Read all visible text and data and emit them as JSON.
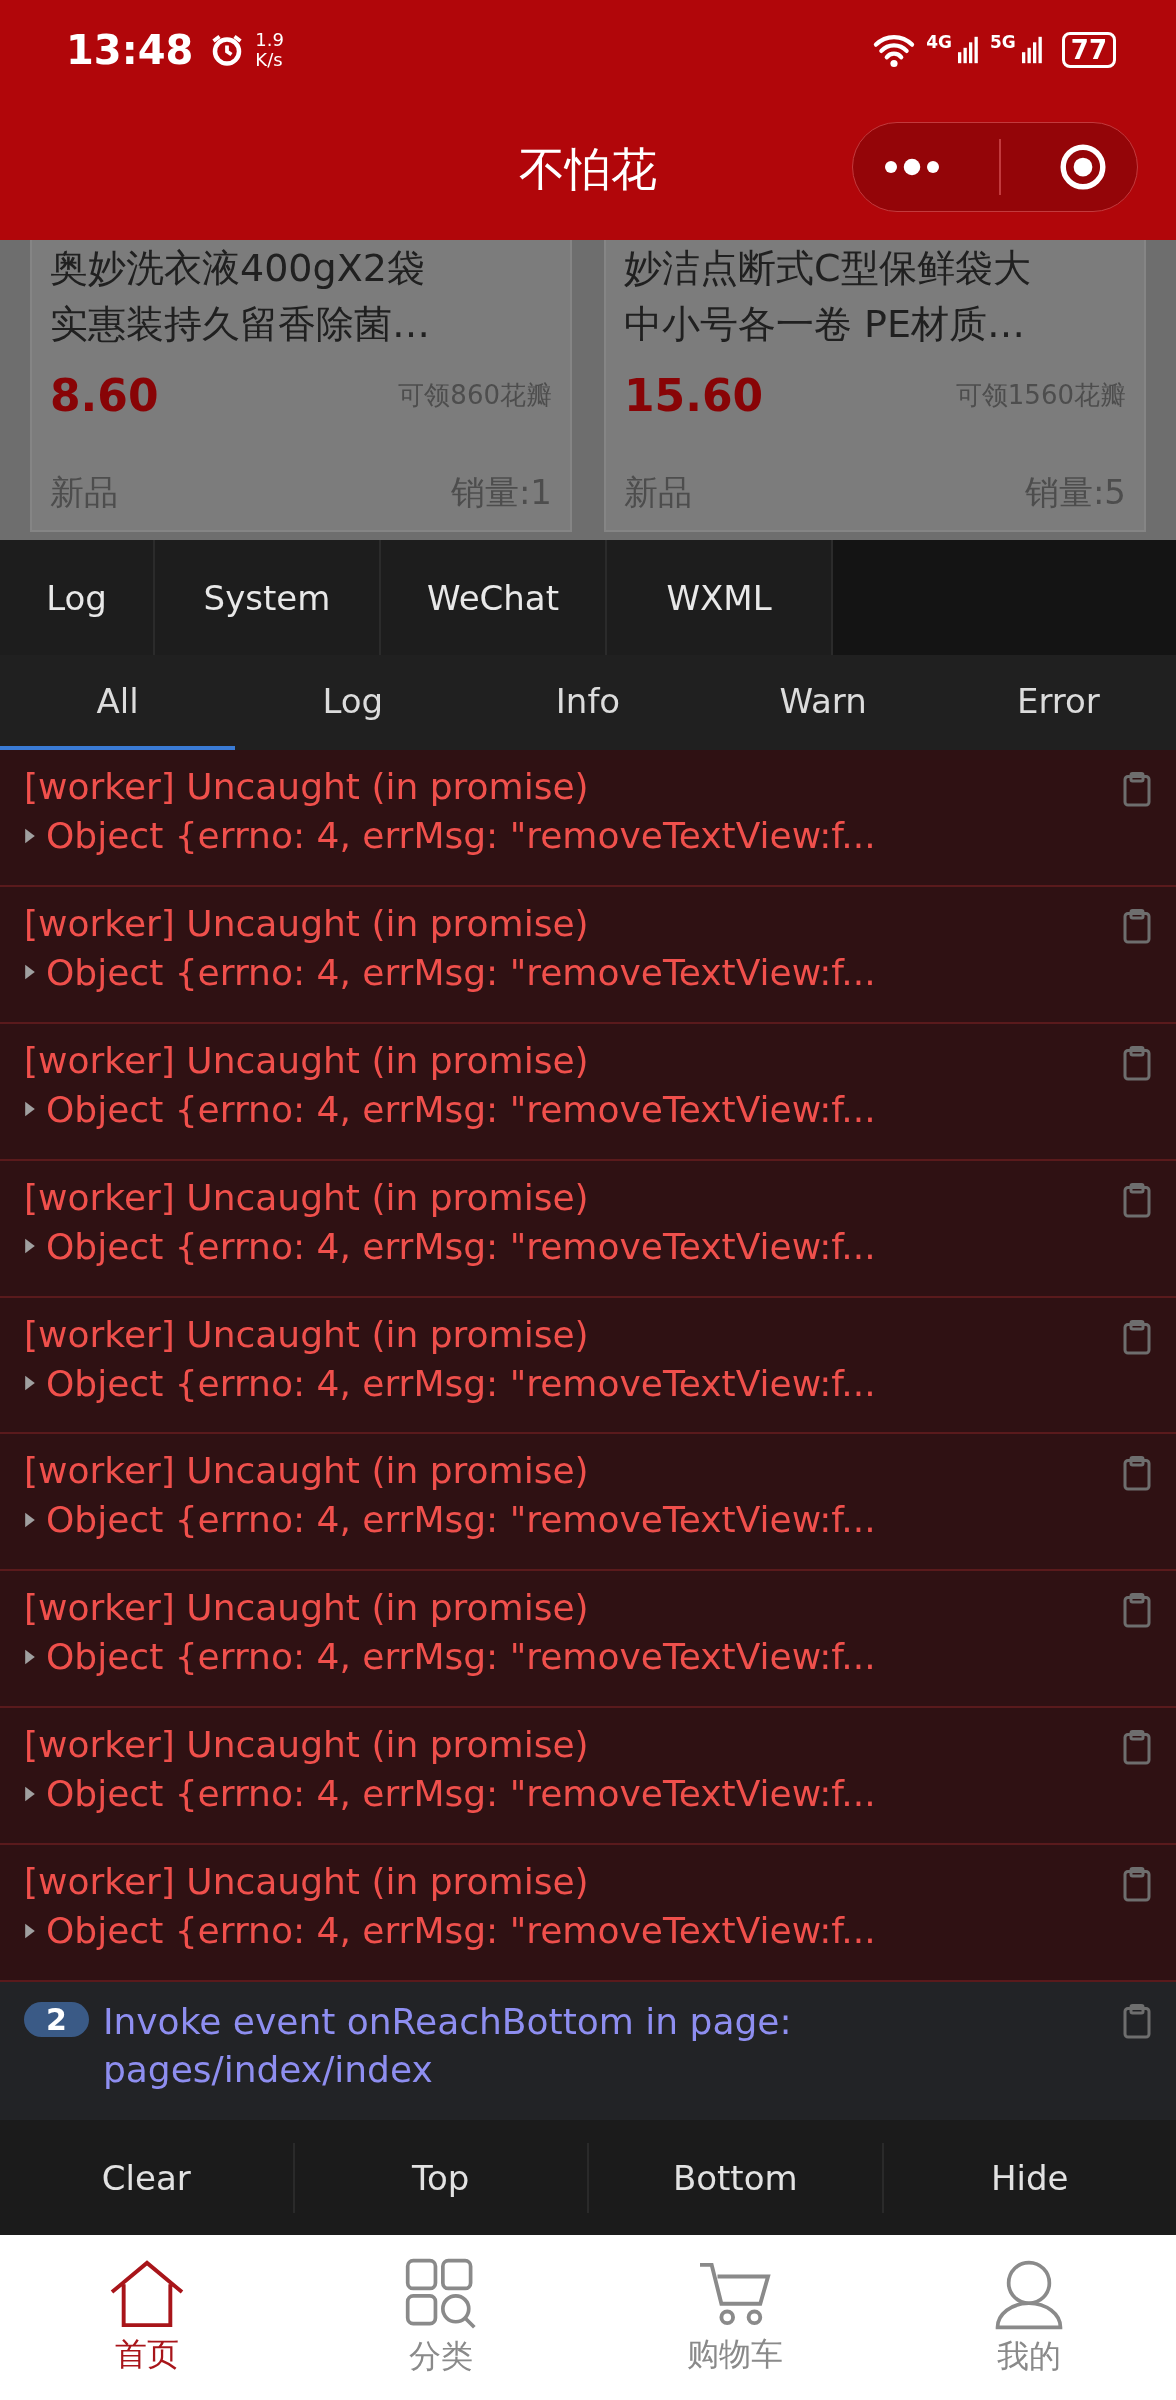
{
  "status_bar": {
    "time": "13:48",
    "speed_value": "1.9",
    "speed_unit": "K/s",
    "network_4g": "4G",
    "network_5g": "5G",
    "battery": "77"
  },
  "header": {
    "title": "不怕花"
  },
  "products": [
    {
      "title_lines": [
        "奥妙洗衣液400gX2袋",
        "实惠装持久留香除菌…"
      ],
      "price": "8.60",
      "reward": "可领860花瓣",
      "tag": "新品",
      "sales": "销量:1"
    },
    {
      "title_lines": [
        "妙洁点断式C型保鲜袋大",
        "中小号各一卷 PE材质…"
      ],
      "price": "15.60",
      "reward": "可领1560花瓣",
      "tag": "新品",
      "sales": "销量:5"
    }
  ],
  "console": {
    "tabs": [
      "Log",
      "System",
      "WeChat",
      "WXML"
    ],
    "filters": [
      {
        "label": "All",
        "selected": true
      },
      {
        "label": "Log",
        "selected": false
      },
      {
        "label": "Info",
        "selected": false
      },
      {
        "label": "Warn",
        "selected": false
      },
      {
        "label": "Error",
        "selected": false
      }
    ],
    "entries": [
      {
        "kind": "error",
        "message": "[worker] Uncaught (in promise)",
        "detail": "Object {errno: 4, errMsg: \"removeTextView:f...",
        "expanded": false
      },
      {
        "kind": "error",
        "message": "[worker] Uncaught (in promise)",
        "detail": "Object {errno: 4, errMsg: \"removeTextView:f...",
        "expanded": false
      },
      {
        "kind": "error",
        "message": "[worker] Uncaught (in promise)",
        "detail": "Object {errno: 4, errMsg: \"removeTextView:f...",
        "expanded": false
      },
      {
        "kind": "error",
        "message": "[worker] Uncaught (in promise)",
        "detail": "Object {errno: 4, errMsg: \"removeTextView:f...",
        "expanded": false
      },
      {
        "kind": "error",
        "message": "[worker] Uncaught (in promise)",
        "detail": "Object {errno: 4, errMsg: \"removeTextView:f...",
        "expanded": false
      },
      {
        "kind": "error",
        "message": "[worker] Uncaught (in promise)",
        "detail": "Object {errno: 4, errMsg: \"removeTextView:f...",
        "expanded": false
      },
      {
        "kind": "error",
        "message": "[worker] Uncaught (in promise)",
        "detail": "Object {errno: 4, errMsg: \"removeTextView:f...",
        "expanded": false
      },
      {
        "kind": "error",
        "message": "[worker] Uncaught (in promise)",
        "detail": "Object {errno: 4, errMsg: \"removeTextView:f...",
        "expanded": false
      },
      {
        "kind": "error",
        "message": "[worker] Uncaught (in promise)",
        "detail": "Object {errno: 4, errMsg: \"removeTextView:f...",
        "expanded": false
      },
      {
        "kind": "info",
        "count": "2",
        "message": "Invoke event onReachBottom in page: pages/index/index"
      }
    ],
    "actions": [
      "Clear",
      "Top",
      "Bottom",
      "Hide"
    ]
  },
  "tab_bar": [
    {
      "label": "首页",
      "kind": "home",
      "selected": true
    },
    {
      "label": "分类",
      "kind": "category",
      "selected": false
    },
    {
      "label": "购物车",
      "kind": "cart",
      "selected": false
    },
    {
      "label": "我的",
      "kind": "profile",
      "selected": false
    }
  ]
}
